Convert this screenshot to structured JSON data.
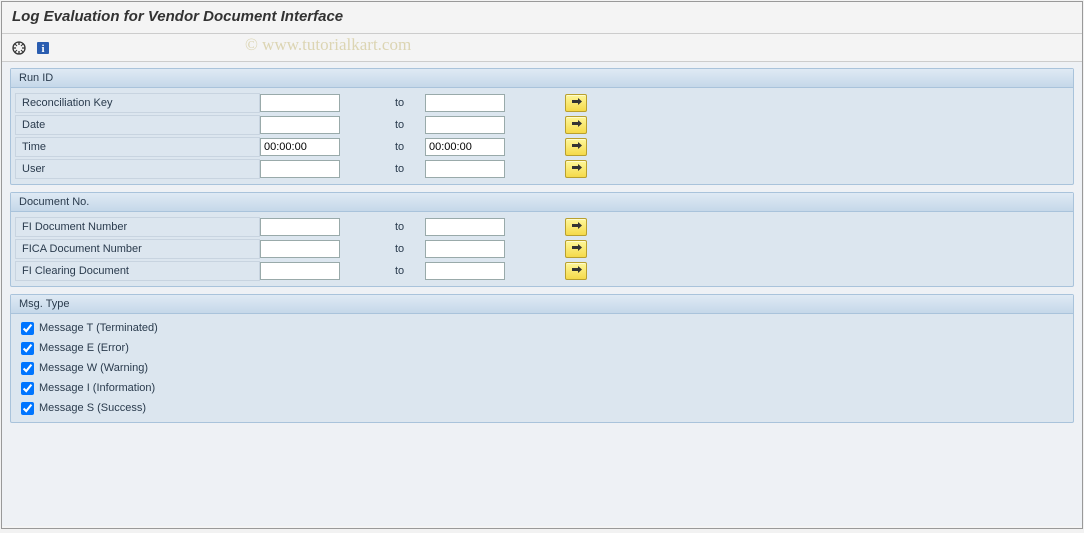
{
  "title": "Log Evaluation for Vendor Document Interface",
  "watermark": "© www.tutorialkart.com",
  "groups": {
    "run_id": {
      "header": "Run ID",
      "rows": [
        {
          "label": "Reconciliation Key",
          "from": "",
          "to_label": "to",
          "to": ""
        },
        {
          "label": "Date",
          "from": "",
          "to_label": "to",
          "to": ""
        },
        {
          "label": "Time",
          "from": "00:00:00",
          "to_label": "to",
          "to": "00:00:00"
        },
        {
          "label": "User",
          "from": "",
          "to_label": "to",
          "to": ""
        }
      ]
    },
    "doc_no": {
      "header": "Document No.",
      "rows": [
        {
          "label": "FI Document Number",
          "from": "",
          "to_label": "to",
          "to": ""
        },
        {
          "label": "FICA Document Number",
          "from": "",
          "to_label": "to",
          "to": ""
        },
        {
          "label": "FI Clearing Document",
          "from": "",
          "to_label": "to",
          "to": ""
        }
      ]
    },
    "msg_type": {
      "header": "Msg. Type",
      "checks": [
        {
          "label": "Message T (Terminated)",
          "checked": true
        },
        {
          "label": "Message E (Error)",
          "checked": true
        },
        {
          "label": "Message W (Warning)",
          "checked": true
        },
        {
          "label": "Message I (Information)",
          "checked": true
        },
        {
          "label": "Message S (Success)",
          "checked": true
        }
      ]
    }
  }
}
